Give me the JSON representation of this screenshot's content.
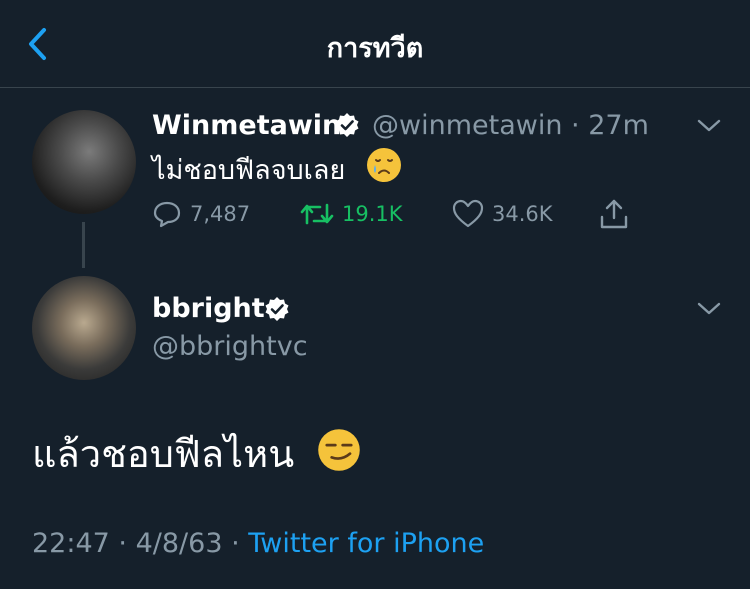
{
  "header": {
    "title": "การทวีต"
  },
  "parent_tweet": {
    "display_name": "Winmetawin",
    "handle": "@winmetawin",
    "separator": "·",
    "time": "27m",
    "text": "ไม่ชอบฟีลจบเลย",
    "emoji_name": "crying-face-emoji",
    "replies": "7,487",
    "retweets": "19.1K",
    "likes": "34.6K"
  },
  "main_tweet": {
    "display_name": "bbright",
    "handle": "@bbrightvc",
    "text": "แล้วชอบฟีลไหน",
    "emoji_name": "smirking-face-emoji",
    "time": "22:47",
    "separator1": "·",
    "date": "4/8/63",
    "separator2": "·",
    "source": "Twitter for iPhone"
  },
  "colors": {
    "background": "#15202b",
    "secondary_text": "#8899a6",
    "accent": "#1da1f2",
    "retweet_green": "#17bf63",
    "divider": "#38444d"
  }
}
